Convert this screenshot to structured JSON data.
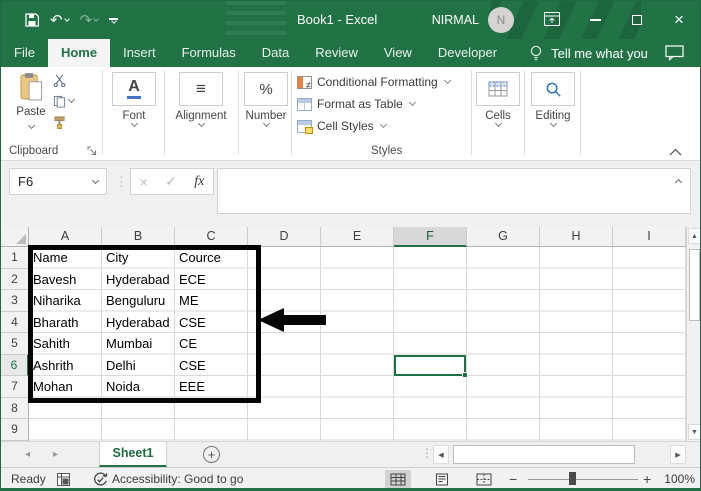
{
  "titlebar": {
    "title": "Book1 - Excel",
    "user": "NIRMAL",
    "user_initial": "N"
  },
  "ribbon_tabs": {
    "items": [
      "File",
      "Home",
      "Insert",
      "Formulas",
      "Data",
      "Review",
      "View",
      "Developer"
    ],
    "active": "Home",
    "tell_me": "Tell me what you"
  },
  "ribbon": {
    "paste_label": "Paste",
    "font_glyph": "A",
    "alignment_glyph": "≡",
    "number_glyph": "%",
    "groups": {
      "clipboard": "Clipboard",
      "font": "Font",
      "alignment": "Alignment",
      "number": "Number",
      "styles": "Styles",
      "cells": "Cells",
      "editing": "Editing"
    },
    "styles_items": [
      "Conditional Formatting",
      "Format as Table",
      "Cell Styles"
    ]
  },
  "formula_bar": {
    "name_box": "F6",
    "cancel_glyph": "×",
    "enter_glyph": "✓",
    "fx_label": "fx",
    "value": ""
  },
  "grid": {
    "columns": [
      "A",
      "B",
      "C",
      "D",
      "E",
      "F",
      "G",
      "H",
      "I"
    ],
    "rows": [
      "1",
      "2",
      "3",
      "4",
      "5",
      "6",
      "7",
      "8",
      "9"
    ],
    "selected_column": "F",
    "selected_row": "6",
    "active_cell": "F6",
    "table": {
      "headers": [
        "Name",
        "City",
        "Cource"
      ],
      "rows": [
        [
          "Bavesh",
          "Hyderabad",
          "ECE"
        ],
        [
          "Niharika",
          "Benguluru",
          "ME"
        ],
        [
          "Bharath",
          "Hyderabad",
          "CSE"
        ],
        [
          "Sahith",
          "Mumbai",
          "CE"
        ],
        [
          "Ashrith",
          "Delhi",
          "CSE"
        ],
        [
          "Mohan",
          "Noida",
          "EEE"
        ]
      ]
    }
  },
  "sheet_tabs": {
    "active": "Sheet1"
  },
  "status_bar": {
    "mode": "Ready",
    "accessibility": "Accessibility: Good to go",
    "zoom_level": "100%"
  },
  "glyphs": {
    "undo": "↶",
    "redo": "↷",
    "dots": "⋮",
    "scroll_up": "▲",
    "scroll_down": "▼",
    "scroll_left": "◀",
    "scroll_right": "▶",
    "sheet_prev": "◂",
    "sheet_next": "▸",
    "new_sheet": "+",
    "zoom_out": "−",
    "zoom_in": "+",
    "close": "×"
  },
  "colors": {
    "excel_green": "#217346",
    "active_cell_border": "#1e7145",
    "annotation": "#000000"
  }
}
